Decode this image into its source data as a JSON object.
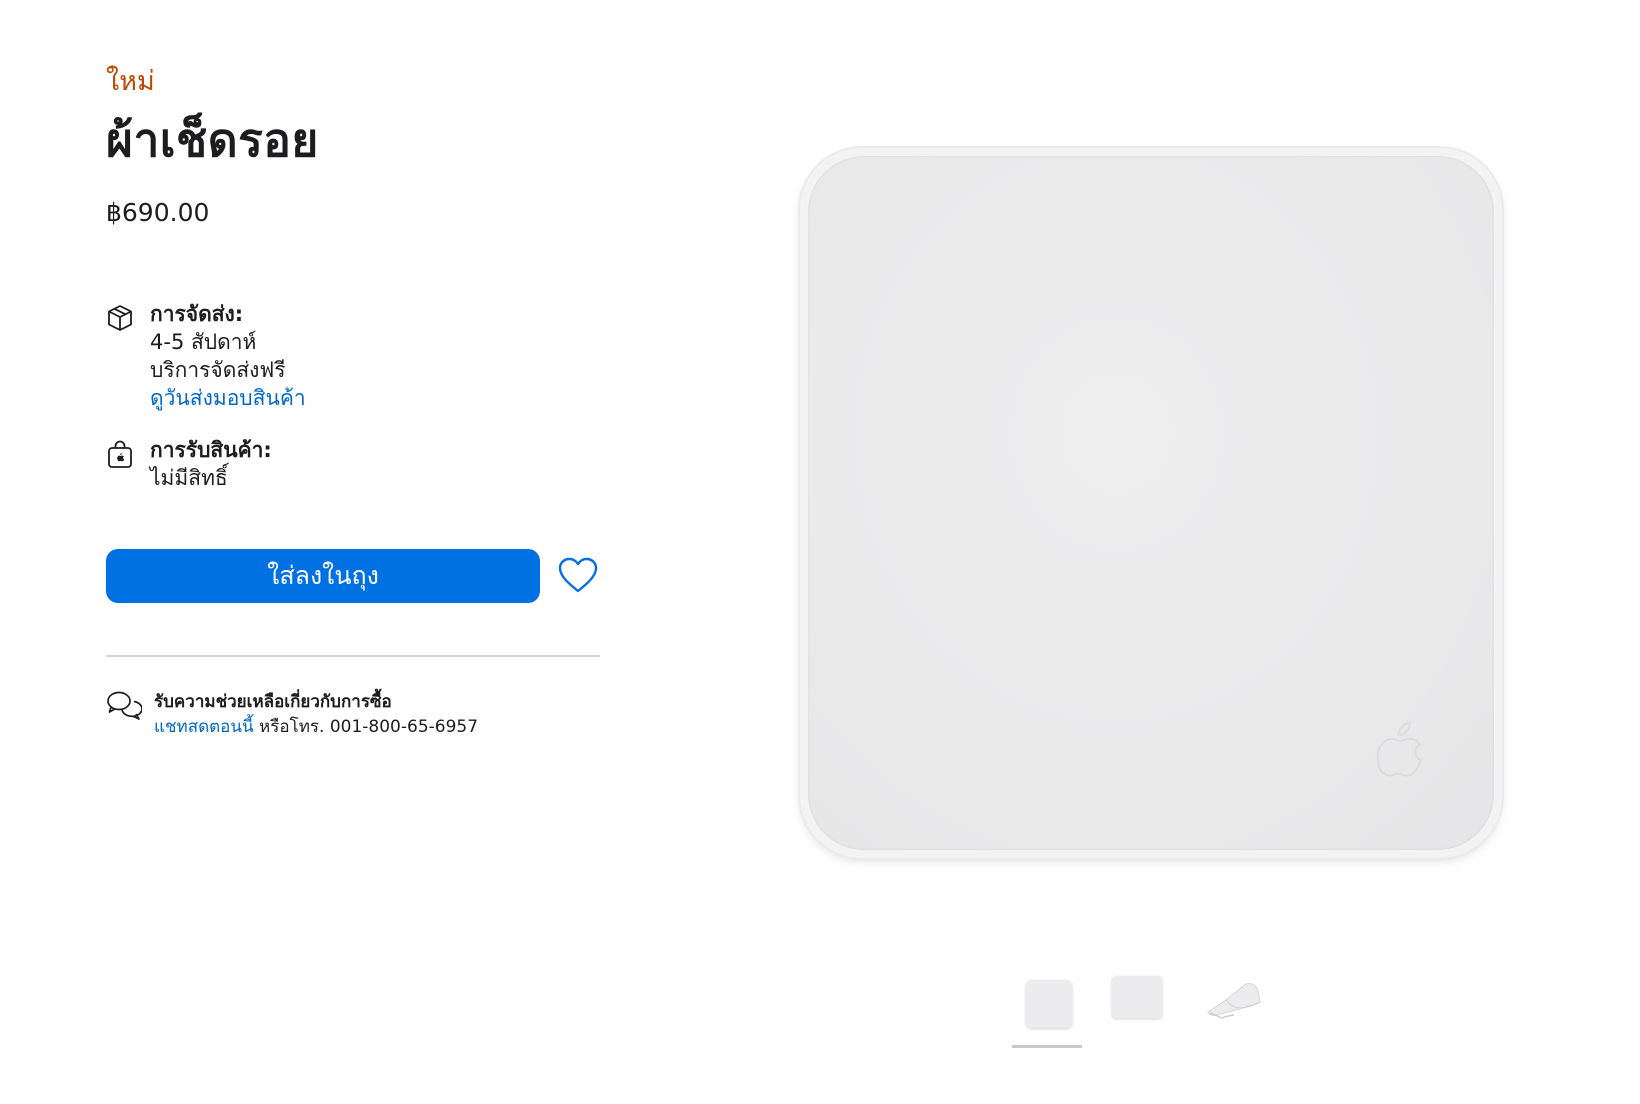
{
  "product": {
    "badge": "ใหม่",
    "title": "ผ้าเช็ดรอย",
    "price": "฿690.00"
  },
  "delivery": {
    "icon": "box-icon",
    "heading": "การจัดส่ง:",
    "eta": "4-5 สัปดาห์",
    "shipping": "บริการจัดส่งฟรี",
    "link": "ดูวันส่งมอบสินค้า"
  },
  "pickup": {
    "icon": "shopping-bag-icon",
    "heading": "การรับสินค้า:",
    "status": "ไม่มีสิทธิ์"
  },
  "actions": {
    "add_to_bag": "ใส่ลงในถุง",
    "favorite_icon": "heart-icon",
    "accent_color": "#0071e3"
  },
  "help": {
    "icon": "chat-bubbles-icon",
    "heading": "รับความช่วยเหลือเกี่ยวกับการซื้อ",
    "chat_link": "แชทสดตอนนี้",
    "phone_text": " หรือโทร. 001-800-65-6957"
  },
  "gallery": {
    "thumbnails": [
      "cloth-front",
      "cloth-flat",
      "cloth-folded"
    ],
    "selected_index": 0
  }
}
